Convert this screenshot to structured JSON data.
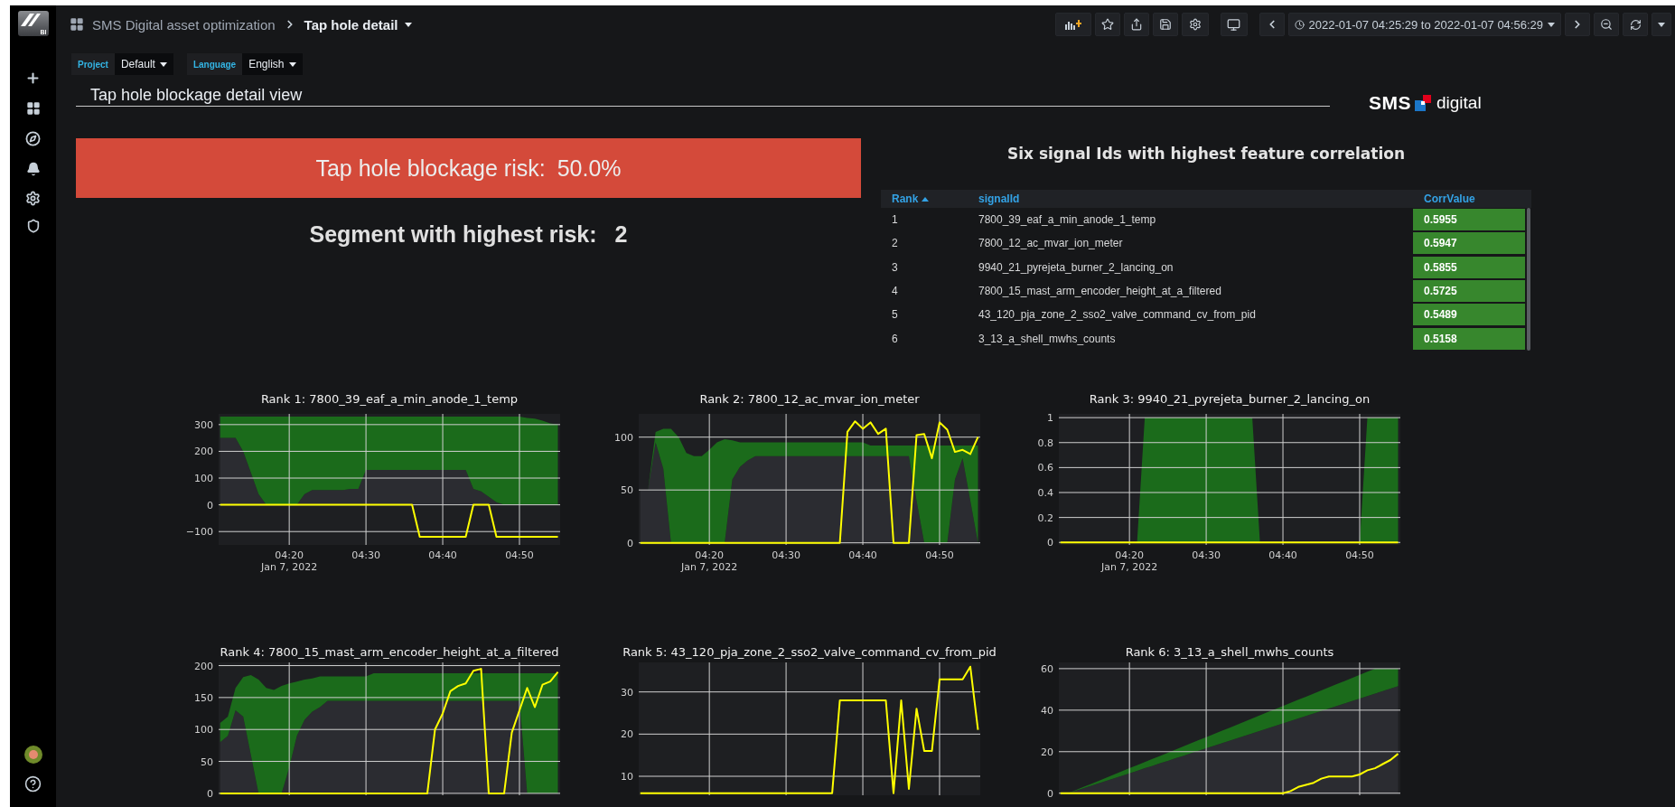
{
  "sidebar": {
    "logo_text": "BI"
  },
  "breadcrumb": {
    "folder": "SMS Digital asset optimization",
    "dashboard": "Tap hole detail"
  },
  "time_range": {
    "label": "2022-01-07 04:25:29 to 2022-01-07 04:56:29"
  },
  "variables": [
    {
      "label": "Project",
      "value": "Default"
    },
    {
      "label": "Language",
      "value": "English"
    }
  ],
  "header": {
    "title": "Tap hole blockage detail view",
    "logo": {
      "wordmark_bold": "SMS",
      "wordmark": "digital"
    }
  },
  "risk": {
    "label": "Tap hole blockage risk:",
    "value": "50.0%"
  },
  "segment": {
    "label": "Segment with highest risk:",
    "value": "2"
  },
  "correlation_table": {
    "title": "Six signal Ids with highest feature correlation",
    "columns": [
      {
        "label": "Rank",
        "sorted": true
      },
      {
        "label": "signalId",
        "sorted": false
      },
      {
        "label": "CorrValue",
        "sorted": false
      }
    ],
    "rows": [
      {
        "rank": "1",
        "signal_id": "7800_39_eaf_a_min_anode_1_temp",
        "corr_value": "0.5955"
      },
      {
        "rank": "2",
        "signal_id": "7800_12_ac_mvar_ion_meter",
        "corr_value": "0.5947"
      },
      {
        "rank": "3",
        "signal_id": "9940_21_pyrejeta_burner_2_lancing_on",
        "corr_value": "0.5855"
      },
      {
        "rank": "4",
        "signal_id": "7800_15_mast_arm_encoder_height_at_a_filtered",
        "corr_value": "0.5725"
      },
      {
        "rank": "5",
        "signal_id": "43_120_pja_zone_2_sso2_valve_command_cv_from_pid",
        "corr_value": "0.5489"
      },
      {
        "rank": "6",
        "signal_id": "3_13_a_shell_mwhs_counts",
        "corr_value": "0.5158"
      }
    ]
  },
  "charts": [
    {
      "title": "Rank 1: 7800_39_eaf_a_min_anode_1_temp",
      "chart_data": {
        "type": "line",
        "grid": true,
        "stacked": true,
        "ylim": [
          -150,
          340
        ],
        "xlabel": "Jan 7, 2022",
        "categories": [
          null,
          null,
          null,
          null,
          null,
          null,
          null,
          null,
          null,
          "04:20",
          null,
          null,
          null,
          null,
          null,
          null,
          null,
          null,
          null,
          "04:30",
          null,
          null,
          null,
          null,
          null,
          null,
          null,
          null,
          null,
          "04:40",
          null,
          null,
          null,
          null,
          null,
          null,
          null,
          null,
          null,
          "04:50",
          null,
          null,
          null,
          null,
          null
        ],
        "yticks": [
          {
            "value": -100,
            "label": "−100"
          },
          0,
          100,
          200,
          300
        ],
        "series": [
          {
            "type": "area",
            "color": "#2b2c31",
            "values": [
              250,
              250,
              250,
              200,
              120,
              40,
              0,
              0,
              0,
              0,
              0,
              40,
              55,
              55,
              55,
              55,
              55,
              60,
              60,
              130,
              130,
              130,
              130,
              130,
              130,
              130,
              130,
              130,
              130,
              130,
              130,
              130,
              130,
              60,
              50,
              30,
              10,
              0,
              0,
              0,
              0,
              0,
              0,
              0,
              0
            ]
          },
          {
            "type": "area",
            "color": "#1b6b1b",
            "values": [
              80,
              80,
              80,
              130,
              210,
              290,
              330,
              330,
              330,
              330,
              330,
              290,
              275,
              275,
              275,
              275,
              275,
              270,
              270,
              200,
              200,
              200,
              200,
              200,
              200,
              200,
              200,
              200,
              200,
              200,
              200,
              200,
              200,
              270,
              280,
              300,
              320,
              330,
              330,
              330,
              325,
              322,
              315,
              305,
              300
            ]
          },
          {
            "type": "line",
            "color": "#ffff00",
            "values": [
              0,
              0,
              0,
              0,
              0,
              0,
              0,
              0,
              0,
              0,
              0,
              0,
              0,
              0,
              0,
              0,
              0,
              0,
              0,
              0,
              0,
              0,
              0,
              0,
              0,
              0,
              -120,
              -120,
              -120,
              -120,
              -120,
              -120,
              -120,
              0,
              0,
              0,
              -120,
              -120,
              -120,
              -120,
              -120,
              -120,
              -120,
              -120,
              -120
            ]
          }
        ]
      }
    },
    {
      "title": "Rank 2: 7800_12_ac_mvar_ion_meter",
      "chart_data": {
        "type": "line",
        "grid": true,
        "stacked": true,
        "ylim": [
          -2,
          122
        ],
        "xlabel": "Jan 7, 2022",
        "categories": [
          null,
          null,
          null,
          null,
          null,
          null,
          null,
          null,
          null,
          "04:20",
          null,
          null,
          null,
          null,
          null,
          null,
          null,
          null,
          null,
          "04:30",
          null,
          null,
          null,
          null,
          null,
          null,
          null,
          null,
          null,
          "04:40",
          null,
          null,
          null,
          null,
          null,
          null,
          null,
          null,
          null,
          "04:50",
          null,
          null,
          null,
          null,
          null
        ],
        "yticks": [
          0,
          50,
          100
        ],
        "series": [
          {
            "type": "area",
            "color": "#2b2c31",
            "values": [
              50,
              50,
              95,
              70,
              0,
              0,
              0,
              0,
              0,
              0,
              0,
              0,
              60,
              72,
              78,
              82,
              82,
              82,
              82,
              82,
              82,
              82,
              82,
              82,
              82,
              82,
              82,
              82,
              82,
              82,
              82,
              82,
              82,
              82,
              82,
              82,
              40,
              0,
              0,
              0,
              0,
              60,
              80,
              40,
              0
            ]
          },
          {
            "type": "area",
            "color": "#1b6b1b",
            "values": [
              0,
              0,
              10,
              38,
              108,
              100,
              85,
              82,
              82,
              88,
              95,
              98,
              37,
              23,
              17,
              13,
              13,
              13,
              13,
              13,
              13,
              13,
              13,
              13,
              13,
              13,
              13,
              13,
              13,
              13,
              10,
              10,
              10,
              10,
              10,
              10,
              52,
              92,
              92,
              92,
              92,
              32,
              12,
              52,
              92
            ]
          },
          {
            "type": "line",
            "color": "#ffff00",
            "values": [
              0,
              0,
              0,
              0,
              0,
              0,
              0,
              0,
              0,
              0,
              0,
              0,
              0,
              0,
              0,
              0,
              0,
              0,
              0,
              0,
              0,
              0,
              0,
              0,
              0,
              0,
              0,
              105,
              115,
              108,
              114,
              103,
              108,
              0,
              0,
              0,
              102,
              103,
              80,
              114,
              107,
              86,
              88,
              84,
              100
            ]
          }
        ]
      }
    },
    {
      "title": "Rank 3: 9940_21_pyrejeta_burner_2_lancing_on",
      "chart_data": {
        "type": "line",
        "grid": true,
        "ylim": [
          -0.02,
          1.03
        ],
        "xlabel": "Jan 7, 2022",
        "categories": [
          null,
          null,
          null,
          null,
          null,
          null,
          null,
          null,
          null,
          "04:20",
          null,
          null,
          null,
          null,
          null,
          null,
          null,
          null,
          null,
          "04:30",
          null,
          null,
          null,
          null,
          null,
          null,
          null,
          null,
          null,
          "04:40",
          null,
          null,
          null,
          null,
          null,
          null,
          null,
          null,
          null,
          "04:50",
          null,
          null,
          null,
          null,
          null
        ],
        "yticks": [
          0,
          0.2,
          0.4,
          0.6,
          0.8,
          1
        ],
        "series": [
          {
            "type": "area",
            "color": "#1b6b1b",
            "values": [
              0,
              0,
              0,
              0,
              0,
              0,
              0,
              0,
              0,
              0,
              0,
              1,
              1,
              1,
              1,
              1,
              1,
              1,
              1,
              1,
              1,
              1,
              1,
              1,
              1,
              1,
              0,
              0,
              0,
              0,
              0,
              0,
              0,
              0,
              0,
              0,
              0,
              0,
              0,
              0,
              1,
              1,
              1,
              1,
              1
            ]
          },
          {
            "type": "line",
            "color": "#ffff00",
            "values": [
              0,
              0,
              0,
              0,
              0,
              0,
              0,
              0,
              0,
              0,
              0,
              0,
              0,
              0,
              0,
              0,
              0,
              0,
              0,
              0,
              0,
              0,
              0,
              0,
              0,
              0,
              0,
              0,
              0,
              0,
              0,
              0,
              0,
              0,
              0,
              0,
              0,
              0,
              0,
              0,
              0,
              0,
              0,
              0,
              0
            ]
          }
        ]
      }
    },
    {
      "title": "Rank 4: 7800_15_mast_arm_encoder_height_at_a_filtered",
      "chart_data": {
        "type": "line",
        "grid": true,
        "stacked": true,
        "ylim": [
          -3,
          205
        ],
        "yticks": [
          0,
          50,
          100,
          150,
          200
        ],
        "series": [
          {
            "type": "area",
            "color": "#2b2c31",
            "values": [
              80,
              90,
              130,
              120,
              60,
              0,
              0,
              0,
              0,
              40,
              90,
              115,
              128,
              135,
              145,
              145,
              145,
              145,
              145,
              145,
              145,
              145,
              145,
              145,
              145,
              145,
              145,
              145,
              145,
              145,
              145,
              145,
              145,
              145,
              145,
              145,
              145,
              145,
              145,
              145,
              0,
              0,
              0,
              0,
              0
            ]
          },
          {
            "type": "area",
            "color": "#1b6b1b",
            "values": [
              30,
              30,
              35,
              62,
              125,
              178,
              165,
              162,
              168,
              132,
              85,
              63,
              52,
              48,
              38,
              38,
              38,
              38,
              38,
              38,
              43,
              43,
              43,
              43,
              43,
              43,
              43,
              43,
              43,
              43,
              43,
              43,
              43,
              43,
              43,
              43,
              43,
              43,
              43,
              43,
              188,
              188,
              188,
              188,
              188
            ]
          },
          {
            "type": "line",
            "color": "#ffff00",
            "values": [
              0,
              0,
              0,
              0,
              0,
              0,
              0,
              0,
              0,
              0,
              0,
              0,
              0,
              0,
              0,
              0,
              0,
              0,
              0,
              0,
              0,
              0,
              0,
              0,
              0,
              0,
              0,
              0,
              100,
              125,
              160,
              168,
              172,
              192,
              195,
              0,
              0,
              0,
              95,
              130,
              165,
              135,
              170,
              175,
              190
            ]
          }
        ]
      }
    },
    {
      "title": "Rank 5: 43_120_pja_zone_2_sso2_valve_command_cv_from_pid",
      "chart_data": {
        "type": "line",
        "grid": true,
        "ylim": [
          5.5,
          37
        ],
        "yticks": [
          10,
          20,
          30
        ],
        "series": [
          {
            "color": "#ffff00",
            "values": [
              6,
              6,
              6,
              6,
              6,
              6,
              6,
              6,
              6,
              6,
              6,
              6,
              6,
              6,
              6,
              6,
              6,
              6,
              6,
              6,
              6,
              6,
              6,
              6,
              6,
              6,
              28,
              28,
              28,
              28,
              28,
              28,
              28,
              6,
              28,
              7,
              26,
              16,
              16,
              33,
              33,
              33,
              33,
              36,
              21
            ]
          }
        ]
      }
    },
    {
      "title": "Rank 6: 3_13_a_shell_mwhs_counts",
      "chart_data": {
        "type": "line",
        "grid": true,
        "stacked": true,
        "ylim": [
          -1,
          63
        ],
        "yticks": [
          0,
          20,
          40,
          60
        ],
        "series": [
          {
            "type": "area",
            "color": "#2b2c31",
            "values": [
              0,
              0,
              1.2,
              2.4,
              3.6,
              4.8,
              6,
              7.2,
              8.4,
              9.6,
              10.8,
              12,
              13.2,
              14.4,
              15.6,
              16.8,
              18,
              19.2,
              20.4,
              21.6,
              22.8,
              24,
              25.2,
              26.4,
              27.6,
              28.8,
              30,
              31.2,
              32.4,
              33.6,
              34.8,
              36,
              37.2,
              38.4,
              39.6,
              40.8,
              42,
              43.2,
              44.4,
              45.6,
              46.8,
              48,
              49.2,
              50.4,
              51.6
            ]
          },
          {
            "type": "area",
            "color": "#1b6b1b",
            "values": [
              0,
              0,
              0.3,
              0.6,
              0.9,
              1.2,
              1.5,
              1.8,
              2.1,
              2.4,
              2.7,
              3,
              3.3,
              3.6,
              3.9,
              4.2,
              4.5,
              4.8,
              5.1,
              5.4,
              5.7,
              6,
              6.3,
              6.6,
              6.9,
              7.2,
              7.5,
              7.8,
              8.1,
              8.4,
              8.7,
              9,
              9.3,
              9.6,
              9.9,
              10.2,
              10.5,
              10.8,
              11.1,
              11.4,
              11.7,
              12,
              10.8,
              9.6,
              8.4
            ]
          },
          {
            "type": "line",
            "color": "#ffff00",
            "values": [
              0,
              0,
              0,
              0,
              0,
              0,
              0,
              0,
              0,
              0,
              0,
              0,
              0,
              0,
              0,
              0,
              0,
              0,
              0,
              0,
              0,
              0,
              0,
              0,
              0,
              0,
              0,
              0,
              0,
              0,
              1,
              3,
              4,
              5,
              7,
              8,
              8,
              8,
              8,
              9,
              11,
              12,
              14,
              16,
              19
            ]
          }
        ]
      }
    }
  ]
}
